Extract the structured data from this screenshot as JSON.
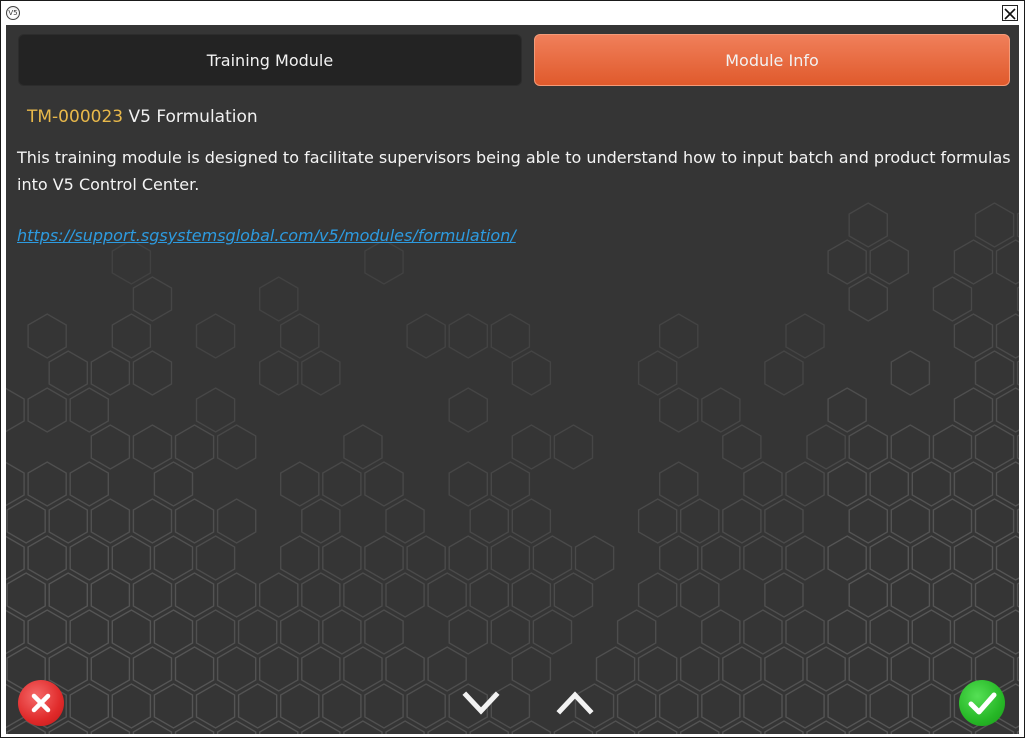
{
  "titlebar": {
    "app_icon_label": "V5",
    "icons": {
      "app": "v5-logo-icon",
      "close": "close-icon"
    }
  },
  "tabs": [
    {
      "label": "Training Module",
      "active": false
    },
    {
      "label": "Module Info",
      "active": true
    }
  ],
  "module": {
    "code": "TM-000023",
    "name": "V5 Formulation",
    "description": "This training module is designed to facilitate supervisors being able to understand how to input batch and product formulas into V5 Control Center.",
    "link": "https://support.sgsystemsglobal.com/v5/modules/formulation/"
  },
  "footer": {
    "icons": {
      "cancel": "cancel-x-icon",
      "scroll_down": "chevron-down-icon",
      "scroll_up": "chevron-up-icon",
      "confirm": "checkmark-icon"
    }
  },
  "colors": {
    "background": "#353535",
    "active_tab": "#e8663a",
    "inactive_tab": "#232323",
    "code_accent": "#e8b84a",
    "link": "#2d9be0",
    "cancel": "#e02a2a",
    "confirm": "#27b827"
  }
}
